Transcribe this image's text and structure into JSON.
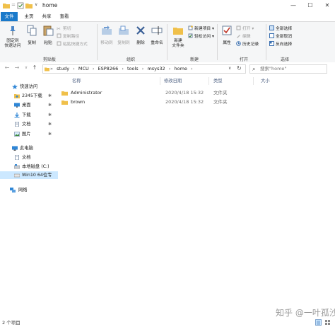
{
  "window": {
    "title": "home",
    "qat_sep": "=",
    "qat_more": "∨",
    "minimize": "—",
    "maximize": "☐",
    "close": "✕"
  },
  "ribbon_tabs": [
    "文件",
    "主页",
    "共享",
    "查看"
  ],
  "ribbon": {
    "clipboard": {
      "label": "剪贴板",
      "pin": "固定到\n快速访问",
      "copy": "复制",
      "paste": "粘贴",
      "cut": "剪切",
      "copy_path": "复制路径",
      "paste_shortcut": "粘贴快捷方式"
    },
    "organize": {
      "label": "组织",
      "move_to": "移动到",
      "copy_to": "复制到",
      "delete": "删除",
      "rename": "重命名"
    },
    "new": {
      "label": "新建",
      "new_folder": "新建\n文件夹",
      "new_item": "新建项目 ▾",
      "easy_access": "轻松访问 ▾"
    },
    "open": {
      "label": "打开",
      "properties": "属性",
      "open": "打开 ▾",
      "edit": "编辑",
      "history": "历史记录"
    },
    "select": {
      "label": "选择",
      "select_all": "全部选择",
      "select_none": "全部取消",
      "invert": "反向选择"
    }
  },
  "nav": {
    "back": "←",
    "forward": "→",
    "recent": "∨",
    "up": "↑",
    "breadcrumbs": [
      "study",
      "MCU",
      "ESP8266",
      "tools",
      "msys32",
      "home"
    ],
    "crumb_sep": "›",
    "lead_sep": "»",
    "refresh": "↻",
    "dropdown": "∨",
    "search_placeholder": "搜索\"home\"",
    "search_icon": "⌕"
  },
  "navpane": {
    "quick_access": "快速访问",
    "pin": "✱",
    "items": [
      {
        "label": "2345下载",
        "icon": "download-icon",
        "pinned": true
      },
      {
        "label": "桌面",
        "icon": "desktop-icon",
        "pinned": true
      },
      {
        "label": "下载",
        "icon": "download-icon",
        "pinned": true
      },
      {
        "label": "文档",
        "icon": "document-icon",
        "pinned": true
      },
      {
        "label": "图片",
        "icon": "picture-icon",
        "pinned": true
      }
    ],
    "this_pc": "此电脑",
    "pc_items": [
      {
        "label": "文档",
        "icon": "document-icon"
      },
      {
        "label": "本地磁盘 (C:)",
        "icon": "drive-icon"
      },
      {
        "label": "Win10 64位专",
        "icon": "drive-icon",
        "selected": true
      }
    ],
    "network": "网络"
  },
  "columns": {
    "name": "名称",
    "date": "修改日期",
    "type": "类型",
    "size": "大小"
  },
  "files": [
    {
      "name": "Administrator",
      "date": "2020/4/18 15:32",
      "type": "文件夹",
      "size": ""
    },
    {
      "name": "brown",
      "date": "2020/4/18 15:32",
      "type": "文件夹",
      "size": ""
    }
  ],
  "status": {
    "count": "2 个项目"
  },
  "watermark": "知乎 @一叶孤沙",
  "colors": {
    "accent": "#1979ca",
    "folder": "#f0c04a",
    "selected": "#cce8ff"
  }
}
